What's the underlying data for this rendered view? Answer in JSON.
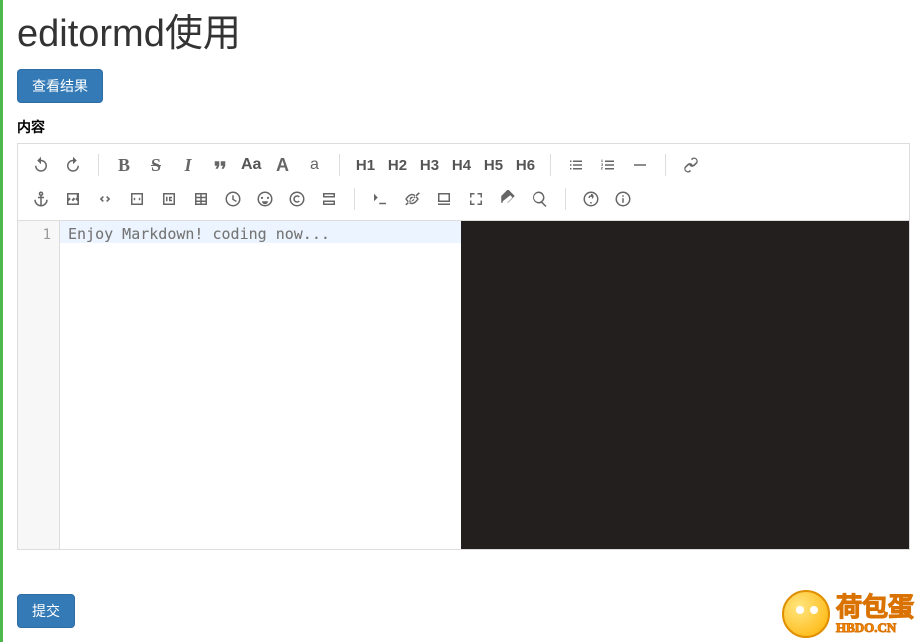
{
  "page": {
    "title": "editormd使用",
    "view_result_btn": "查看结果",
    "section_label": "内容",
    "submit_btn": "提交"
  },
  "editor": {
    "placeholder": "Enjoy Markdown! coding now...",
    "line_number": "1",
    "content": ""
  },
  "toolbar_row1": {
    "undo": "↺",
    "redo": "↻",
    "bold": "B",
    "strike": "S",
    "italic": "I",
    "quote": "❝",
    "text_case": "Aa",
    "uppercase": "A",
    "lowercase": "a",
    "h1": "H1",
    "h2": "H2",
    "h3": "H3",
    "h4": "H4",
    "h5": "H5",
    "h6": "H6",
    "ul": "≡",
    "ol": "≡",
    "hr": "—",
    "link": "🔗"
  },
  "watermark": {
    "cn": "荷包蛋",
    "url": "HBDO.CN"
  }
}
